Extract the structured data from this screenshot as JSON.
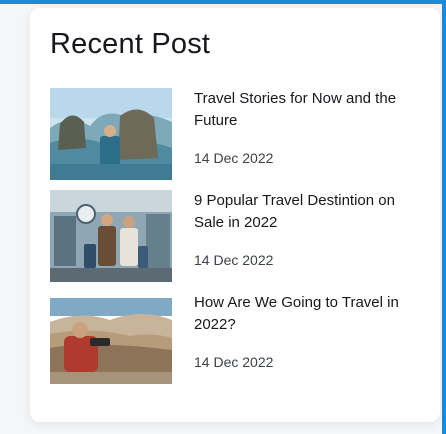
{
  "widget": {
    "title": "Recent Post"
  },
  "posts": [
    {
      "title": "Travel Stories for Now and the Future",
      "date": "14 Dec 2022"
    },
    {
      "title": "9 Popular Travel Destintion on Sale in 2022",
      "date": "14 Dec 2022"
    },
    {
      "title": "How Are We Going to Travel in 2022?",
      "date": "14 Dec 2022"
    }
  ],
  "colors": {
    "accent": "#1b8bd8",
    "text": "#16181d",
    "muted_text": "#3d4148"
  }
}
